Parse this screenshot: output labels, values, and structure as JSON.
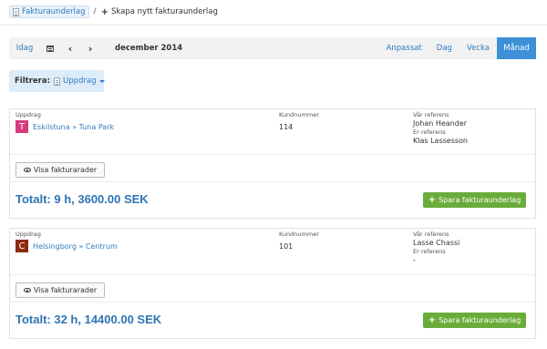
{
  "breadcrumb": {
    "parent": "Fakturaunderlag",
    "separator": "/",
    "current": "Skapa nytt fakturaunderlag"
  },
  "toolbar": {
    "today": "Idag",
    "title": "december 2014",
    "views": [
      "Anpassat",
      "Dag",
      "Vecka",
      "Månad"
    ],
    "active_view": "Månad"
  },
  "filter": {
    "label": "Filtrera:",
    "dropdown": "Uppdrag"
  },
  "cards": [
    {
      "col1_label": "Uppdrag",
      "avatar_letter": "T",
      "avatar_color": "#d63a7f",
      "project": "Eskilstuna » Tuna Park",
      "col2_label": "Kundnummer",
      "customer_number": "114",
      "col3_label": "Vår referens",
      "our_reference": "Johan Heander",
      "their_ref_label": "Er referens",
      "their_reference": "Klas Lassesson",
      "show_button": "Visa fakturarader",
      "total": "Totalt: 9 h, 3600.00 SEK",
      "save_button": "Spara fakturaunderlag"
    },
    {
      "col1_label": "Uppdrag",
      "avatar_letter": "C",
      "avatar_color": "#8c2a10",
      "project": "Helsingborg » Centrum",
      "col2_label": "Kundnummer",
      "customer_number": "101",
      "col3_label": "Vår referens",
      "our_reference": "Lasse Chassi",
      "their_ref_label": "Er referens",
      "their_reference": "-",
      "show_button": "Visa fakturarader",
      "total": "Totalt: 32 h, 14400.00 SEK",
      "save_button": "Spara fakturaunderlag"
    }
  ]
}
